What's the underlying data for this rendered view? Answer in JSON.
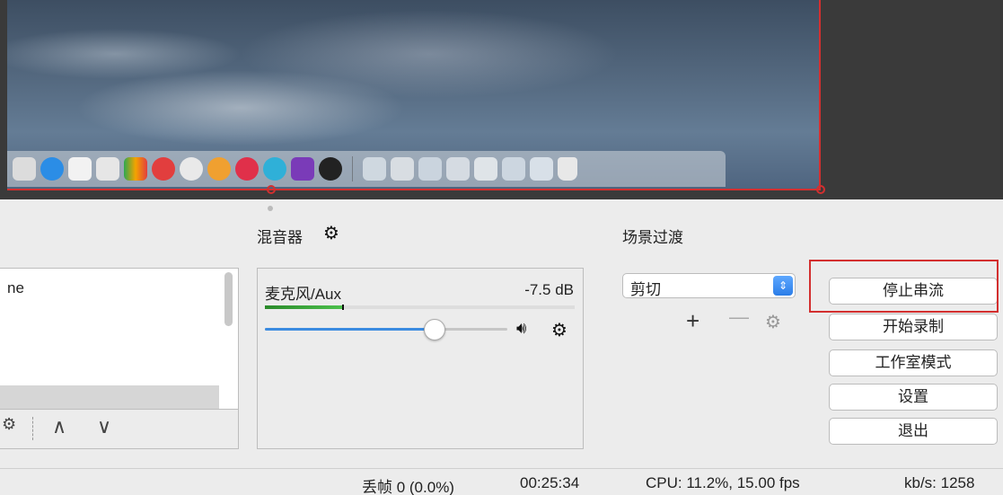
{
  "preview": {
    "dock_icons": [
      "finder-icon",
      "appstore-icon",
      "typora-icon",
      "textedit-icon",
      "numbers-icon",
      "netease-music-icon",
      "wechat-icon",
      "paint-icon",
      "h-app-icon",
      "mindnode-icon",
      "rp-icon",
      "obs-icon",
      "screenshot-1-icon",
      "screenshot-2-icon",
      "screenshot-3-icon",
      "screenshot-4-icon",
      "screenshot-5-icon",
      "screenshot-6-icon",
      "screenshot-7-icon",
      "trash-icon"
    ]
  },
  "scenes": {
    "item_text": "ne",
    "toolbar": {
      "settings_icon": "gear-icon",
      "up_label": "∧",
      "down_label": "∨"
    }
  },
  "mixer": {
    "title": "混音器",
    "source_name": "麦克风/Aux",
    "db_value": "-7.5 dB",
    "meter_level": 0.25,
    "volume_level": 0.7
  },
  "transitions": {
    "title": "场景过渡",
    "selected": "剪切",
    "add_label": "+",
    "remove_label": "—"
  },
  "controls": {
    "stop_stream": "停止串流",
    "start_recording": "开始录制",
    "studio_mode": "工作室模式",
    "settings": "设置",
    "exit": "退出"
  },
  "status": {
    "dropped_frames": "丢帧 0 (0.0%)",
    "time": "00:25:34",
    "cpu": "CPU: 11.2%, 15.00 fps",
    "bitrate": "kb/s: 1258"
  },
  "colors": {
    "highlight": "#d32f2f",
    "slider": "#3b8be0",
    "meter": "#3fae3f"
  }
}
